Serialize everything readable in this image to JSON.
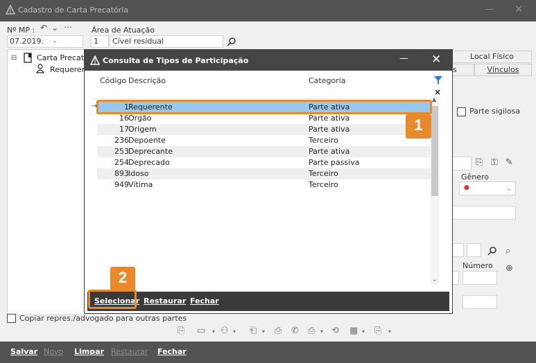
{
  "main_window": {
    "title": "Cadastro de Carta Precatória",
    "mp_label": "Nº MP :",
    "mp_value": "07.2019.",
    "mp_dash": "-",
    "area_label": "Área de Atuação",
    "area_code": "1",
    "area_value": "Cível residual",
    "tree_root": "Carta Precató",
    "tree_child": "Requerente",
    "tab_local_fisico": "Local Físico",
    "tab_s": "s",
    "tab_vinculos": "Vínculos",
    "parte_sigilosa": "Parte sigilosa",
    "genero_label": "Gênero",
    "numero_label": "Número",
    "copiar_label": "Copiar repres./advogado para outras partes",
    "genero_dot_color": "#e03030"
  },
  "bottom_bar": {
    "salvar": "Salvar",
    "novo": "Novo",
    "limpar": "Limpar",
    "restaurar": "Restaurar",
    "fechar": "Fechar"
  },
  "dialog": {
    "title": "Consulta de Tipos de Participação",
    "columns": {
      "codigo": "Código",
      "descricao": "Descrição",
      "categoria": "Categoria"
    },
    "rows": [
      {
        "codigo": "1",
        "descricao": "Requerente",
        "categoria": "Parte ativa"
      },
      {
        "codigo": "16",
        "descricao": "Orgão",
        "categoria": "Parte ativa"
      },
      {
        "codigo": "17",
        "descricao": "Origem",
        "categoria": "Parte ativa"
      },
      {
        "codigo": "236",
        "descricao": "Depoente",
        "categoria": "Terceiro"
      },
      {
        "codigo": "253",
        "descricao": "Deprecante",
        "categoria": "Parte ativa"
      },
      {
        "codigo": "254",
        "descricao": "Deprecado",
        "categoria": "Parte passiva"
      },
      {
        "codigo": "893",
        "descricao": "Idoso",
        "categoria": "Terceiro"
      },
      {
        "codigo": "949",
        "descricao": "Vítima",
        "categoria": "Terceiro"
      }
    ],
    "footer": {
      "selecionar": "Selecionar",
      "restaurar": "Restaurar",
      "fechar": "Fechar"
    }
  },
  "annotations": {
    "badge1": "1",
    "badge2": "2",
    "accent_color": "#e8892b"
  }
}
